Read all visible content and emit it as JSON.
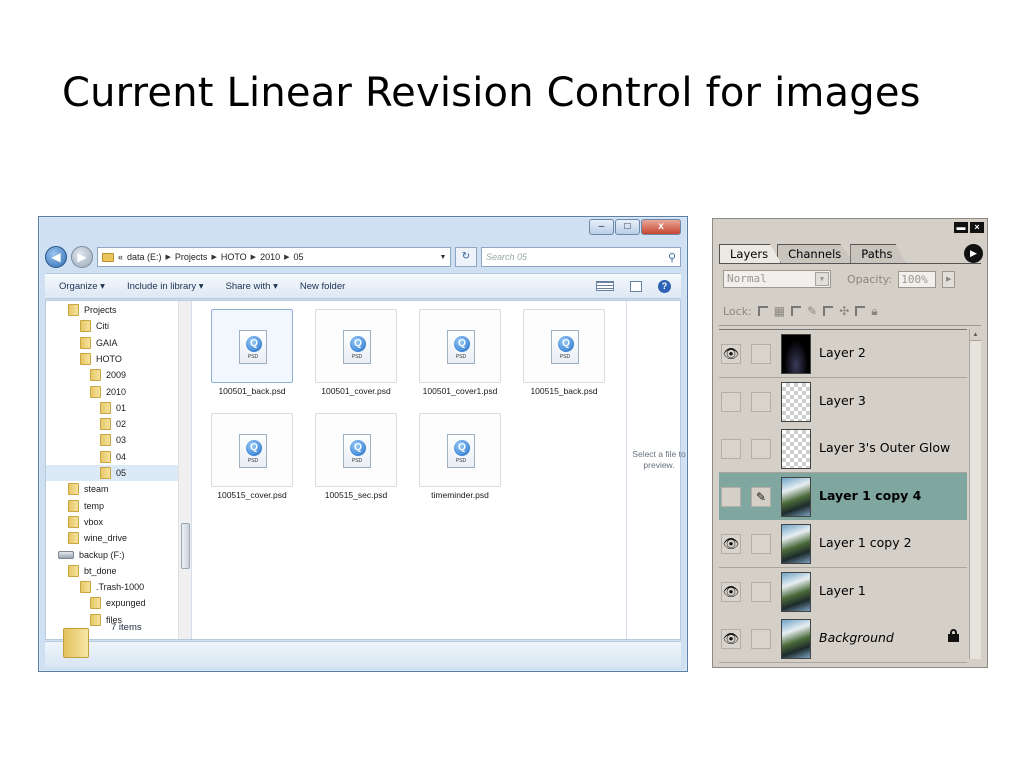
{
  "slide": {
    "title": "Current Linear Revision Control for images"
  },
  "explorer": {
    "window_buttons": {
      "minimize": "–",
      "maximize": "□",
      "close": "x"
    },
    "breadcrumb": [
      "data (E:)",
      "Projects",
      "HOTO",
      "2010",
      "05"
    ],
    "breadcrumb_prefix": "«",
    "search_placeholder": "Search 05",
    "toolbar": {
      "organize": "Organize ▾",
      "include": "Include in library ▾",
      "share": "Share with ▾",
      "new_folder": "New folder"
    },
    "tree": [
      {
        "label": "Projects",
        "level": 1,
        "icon": "folder-icon"
      },
      {
        "label": "Citi",
        "level": 2,
        "icon": "folder-icon"
      },
      {
        "label": "GAIA",
        "level": 2,
        "icon": "folder-icon"
      },
      {
        "label": "HOTO",
        "level": 2,
        "icon": "folder-icon"
      },
      {
        "label": "2009",
        "level": 3,
        "icon": "folder-icon"
      },
      {
        "label": "2010",
        "level": 3,
        "icon": "folder-icon"
      },
      {
        "label": "01",
        "level": 4,
        "icon": "folder-icon"
      },
      {
        "label": "02",
        "level": 4,
        "icon": "folder-icon"
      },
      {
        "label": "03",
        "level": 4,
        "icon": "folder-icon"
      },
      {
        "label": "04",
        "level": 4,
        "icon": "folder-icon"
      },
      {
        "label": "05",
        "level": 4,
        "icon": "folder-icon",
        "selected": true
      },
      {
        "label": "steam",
        "level": 1,
        "icon": "folder-icon"
      },
      {
        "label": "temp",
        "level": 1,
        "icon": "folder-icon"
      },
      {
        "label": "vbox",
        "level": 1,
        "icon": "folder-icon"
      },
      {
        "label": "wine_drive",
        "level": 1,
        "icon": "folder-icon"
      },
      {
        "label": "backup (F:)",
        "level": 0,
        "icon": "drive-icon"
      },
      {
        "label": "bt_done",
        "level": 1,
        "icon": "folder-icon"
      },
      {
        "label": ".Trash-1000",
        "level": 2,
        "icon": "folder-icon"
      },
      {
        "label": "expunged",
        "level": 3,
        "icon": "folder-icon"
      },
      {
        "label": "files",
        "level": 3,
        "icon": "folder-icon"
      }
    ],
    "files": [
      {
        "name": "100501_back.psd",
        "selected": true
      },
      {
        "name": "100501_cover.psd"
      },
      {
        "name": "100501_cover1.psd"
      },
      {
        "name": "100515_back.psd"
      },
      {
        "name": "100515_cover.psd"
      },
      {
        "name": "100515_sec.psd"
      },
      {
        "name": "timeminder.psd"
      }
    ],
    "file_icon_tag": "PSD",
    "preview_text": "Select a file to preview.",
    "status": "7 items"
  },
  "layers_panel": {
    "tabs": [
      "Layers",
      "Channels",
      "Paths"
    ],
    "active_tab": "Layers",
    "blend_mode": "Normal",
    "opacity_label": "Opacity:",
    "opacity_value": "100%",
    "lock_label": "Lock:",
    "layers": [
      {
        "name": "Layer 2",
        "visible": true,
        "thumb": "black"
      },
      {
        "name": "Layer 3",
        "visible": false,
        "thumb": "transparent"
      },
      {
        "name": "Layer 3's Outer Glow",
        "visible": false,
        "thumb": "transparent"
      },
      {
        "name": "Layer 1 copy 4",
        "visible": false,
        "thumb": "photo",
        "active": true,
        "brush": true
      },
      {
        "name": "Layer 1 copy 2",
        "visible": true,
        "thumb": "photo"
      },
      {
        "name": "Layer 1",
        "visible": true,
        "thumb": "photo"
      },
      {
        "name": "Background",
        "visible": true,
        "thumb": "photo",
        "locked": true
      }
    ]
  }
}
